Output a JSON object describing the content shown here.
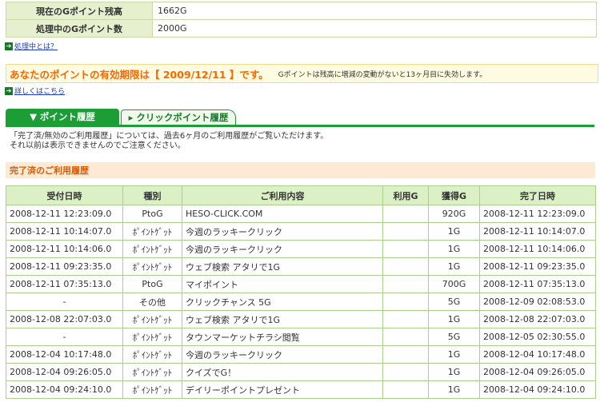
{
  "summary": [
    {
      "label": "現在のGポイント残高",
      "value": "1662G"
    },
    {
      "label": "処理中のGポイント数",
      "value": "2000G"
    }
  ],
  "processing_link": "処理中とは？",
  "expiry": {
    "main": "あなたのポイントの有効期限は【 2009/12/11 】です。",
    "note": "Gポイントは残高に増減の変動がないと13ヶ月目に失効します。"
  },
  "details_link": "詳しくはこちら",
  "tabs": [
    {
      "label": "▼ ポイント履歴"
    },
    {
      "label": "▸ クリックポイント履歴"
    }
  ],
  "notice": [
    "「完了済/無効のご利用履歴」については、過去6ヶ月のご利用履歴がご覧いただけます。",
    "それ以前は表示できませんのでご注意ください。"
  ],
  "section_title": "完了済のご利用履歴",
  "table": {
    "headers": [
      "受付日時",
      "種別",
      "ご利用内容",
      "利用G",
      "獲得G",
      "完了日時"
    ],
    "rows": [
      [
        "2008-12-11 12:23:09.0",
        "PtoG",
        "HESO-CLICK.COM",
        "",
        "920G",
        "2008-12-11 12:23:09.0"
      ],
      [
        "2008-12-11 10:14:07.0",
        "ﾎﾟｲﾝﾄｹﾞｯﾄ",
        "今週のラッキークリック",
        "",
        "1G",
        "2008-12-11 10:14:07.0"
      ],
      [
        "2008-12-11 10:14:06.0",
        "ﾎﾟｲﾝﾄｹﾞｯﾄ",
        "今週のラッキークリック",
        "",
        "1G",
        "2008-12-11 10:14:06.0"
      ],
      [
        "2008-12-11 09:23:35.0",
        "ﾎﾟｲﾝﾄｹﾞｯﾄ",
        "ウェブ検索 アタリで1G",
        "",
        "1G",
        "2008-12-11 09:23:35.0"
      ],
      [
        "2008-12-11 07:35:13.0",
        "PtoG",
        "マイポイント",
        "",
        "700G",
        "2008-12-11 07:35:13.0"
      ],
      [
        "-",
        "その他",
        "クリックチャンス 5G",
        "",
        "5G",
        "2008-12-09 02:08:53.0"
      ],
      [
        "2008-12-08 22:07:03.0",
        "ﾎﾟｲﾝﾄｹﾞｯﾄ",
        "ウェブ検索 アタリで1G",
        "",
        "1G",
        "2008-12-08 22:07:03.0"
      ],
      [
        "-",
        "ﾎﾟｲﾝﾄｹﾞｯﾄ",
        "タウンマーケットチラシ閲覧",
        "",
        "5G",
        "2008-12-05 02:30:55.0"
      ],
      [
        "2008-12-04 10:17:48.0",
        "ﾎﾟｲﾝﾄｹﾞｯﾄ",
        "今週のラッキークリック",
        "",
        "1G",
        "2008-12-04 10:17:48.0"
      ],
      [
        "2008-12-04 09:26:05.0",
        "ﾎﾟｲﾝﾄｹﾞｯﾄ",
        "クイズでG！",
        "",
        "1G",
        "2008-12-04 09:26:05.0"
      ],
      [
        "2008-12-04 09:24:10.0",
        "ﾎﾟｲﾝﾄｹﾞｯﾄ",
        "デイリーポイントプレゼント",
        "",
        "1G",
        "2008-12-04 09:24:10.0"
      ]
    ]
  }
}
